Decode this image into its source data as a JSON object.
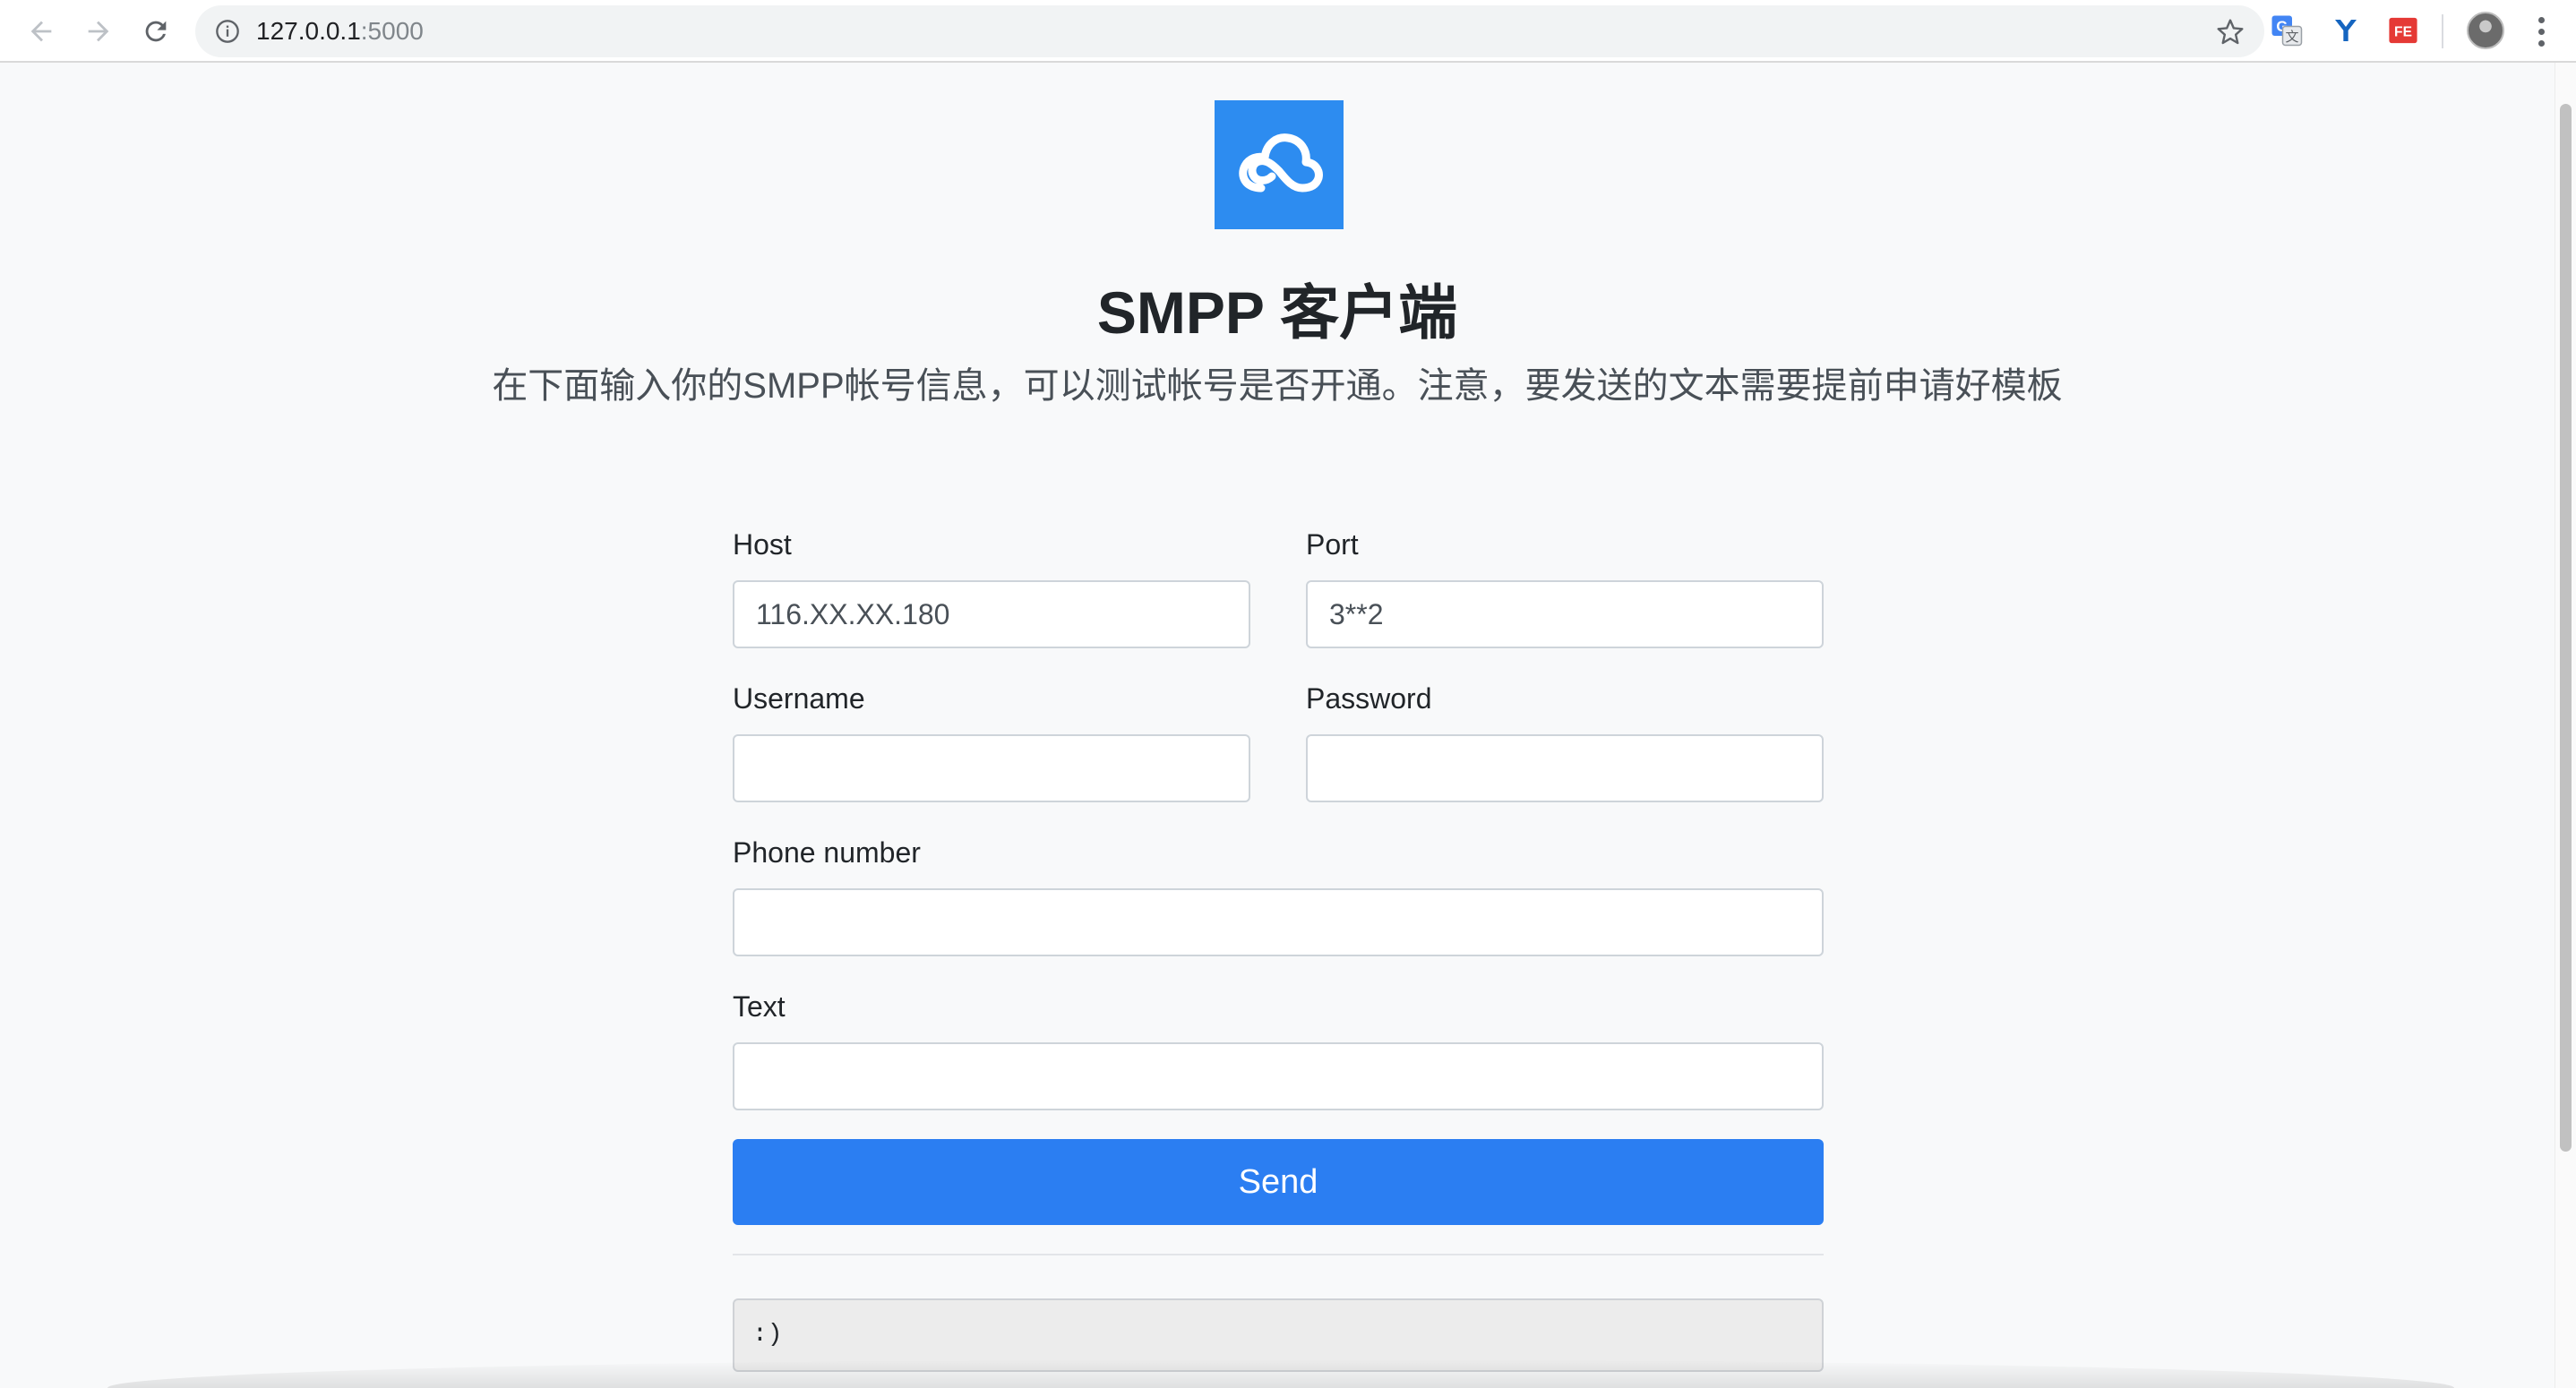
{
  "browser": {
    "url_host": "127.0.0.1",
    "url_port": ":5000",
    "extensions": [
      "translate-icon",
      "y-extension-icon",
      "fe-extension-icon"
    ],
    "extension_fe_label": "FE"
  },
  "page": {
    "title": "SMPP 客户端",
    "subtitle": "在下面输入你的SMPP帐号信息，可以测试帐号是否开通。注意，要发送的文本需要提前申请好模板",
    "logo_icon": "cloud-icon",
    "logo_color": "#2d8cf0"
  },
  "form": {
    "host": {
      "label": "Host",
      "value": "116.XX.XX.180"
    },
    "port": {
      "label": "Port",
      "value": "3**2"
    },
    "username": {
      "label": "Username",
      "value": ""
    },
    "password": {
      "label": "Password",
      "value": ""
    },
    "phone": {
      "label": "Phone number",
      "value": ""
    },
    "text": {
      "label": "Text",
      "value": ""
    },
    "send_label": "Send",
    "send_color": "#2b7ef2"
  },
  "output": {
    "text": ":)"
  }
}
